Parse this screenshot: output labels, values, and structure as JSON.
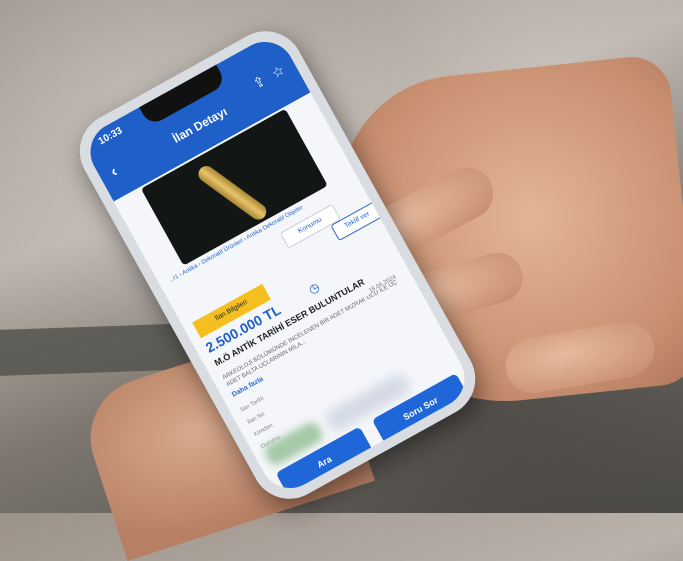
{
  "status_bar": {
    "time": "10:33"
  },
  "header": {
    "title": "İlan Detayı",
    "back_icon": "chevron-left-icon",
    "share_icon": "share-icon",
    "favorite_icon": "star-icon"
  },
  "listing": {
    "breadcrumb": "...r1 › Antika › Dekoratif Ürünleri › Antika Dekoratif Objeler",
    "location_button": "Konumu",
    "offer_button": "Teklif ver",
    "active_tab": "İlan Bilgileri",
    "price": "2.500.000 TL",
    "title": "M.Ö ANTİK TARİHİ ESER BULUNTULAR",
    "date": "18.06.2024",
    "description": "ARKEOLOJİ BÖLÜMÜNDE İNCELENEN BİR ADET MIZRAK UCU İLE ÜÇ ADET BALTA UÇLARININ MİLA...",
    "more_link": "Daha fazla",
    "field_labels": [
      "İlan Tarihi",
      "İlan No",
      "Kimden",
      "Durumu"
    ]
  },
  "actions": {
    "call": "Ara",
    "ask": "Soru Sor"
  }
}
